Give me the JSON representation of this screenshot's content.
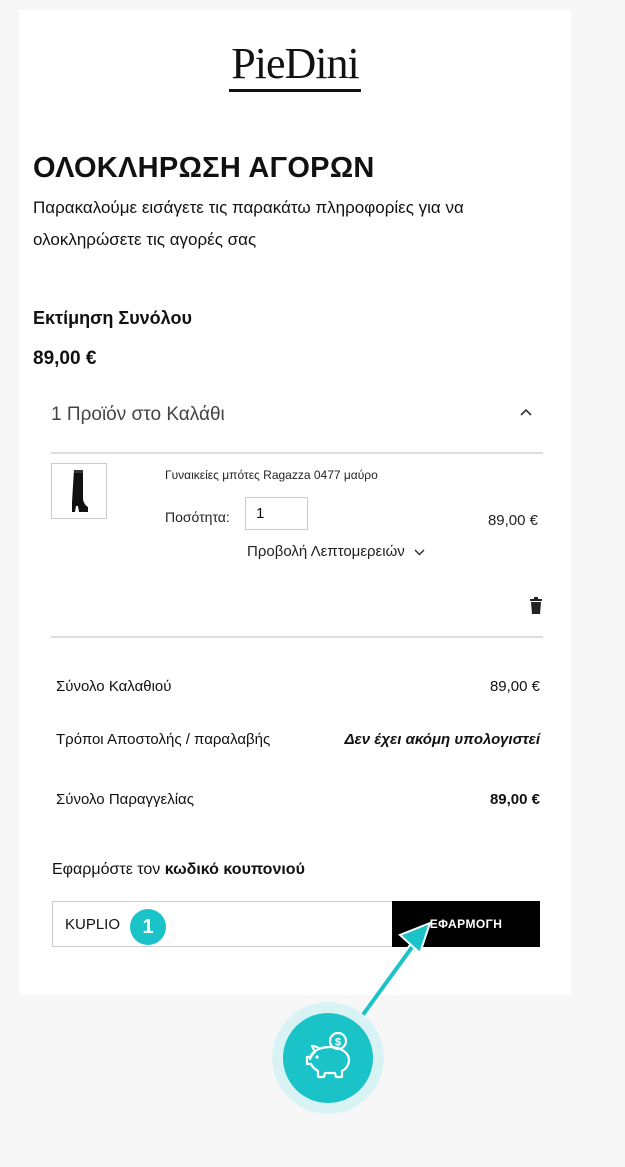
{
  "brand": {
    "logo_text": "PieDini"
  },
  "checkout": {
    "title": "ΟΛΟΚΛΗΡΩΣΗ ΑΓΟΡΩΝ",
    "intro": "Παρακαλούμε εισάγετε τις παρακάτω πληροφορίες για να ολοκληρώσετε τις αγορές σας"
  },
  "estimate": {
    "label": "Εκτίμηση Συνόλου",
    "total": "89,00 €"
  },
  "cart": {
    "count_label": "1 Προϊόν στο Καλάθι",
    "toggle_icon": "chevron-up-icon",
    "item": {
      "name": "Γυναικείες μπότες Ragazza 0477 μαύρο",
      "qty_label": "Ποσότητα:",
      "qty_value": "1",
      "price": "89,00 €",
      "details_label": "Προβολή Λεπτομερειών",
      "thumbnail_icon": "boot-image",
      "remove_icon": "trash-icon"
    }
  },
  "summary": {
    "cart_total_label": "Σύνολο Καλαθιού",
    "cart_total_value": "89,00 €",
    "shipping_label": "Τρόποι Αποστολής / παραλαβής",
    "shipping_value": "Δεν έχει ακόμη υπολογιστεί",
    "order_total_label": "Σύνολο Παραγγελίας",
    "order_total_value": "89,00 €"
  },
  "coupon": {
    "heading_prefix": "Εφαρμόστε τον",
    "heading_bold": "κωδικό κουπονιού",
    "code_value": "KUPLIO",
    "apply_label": "ΕΦΑΡΜΟΓΗ"
  },
  "annotation": {
    "step_number": "1",
    "accent_color": "#19c3c8",
    "arrow_icon": "arrow-icon",
    "badge_icon": "piggy-bank-coin-icon"
  }
}
